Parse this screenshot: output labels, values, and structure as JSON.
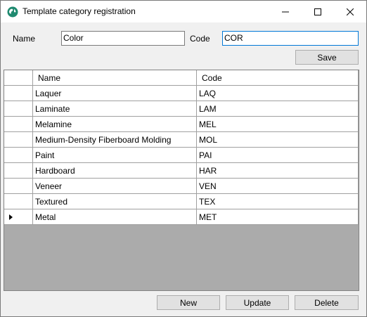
{
  "window": {
    "title": "Template category registration",
    "icons": {
      "app": "globe-icon",
      "minimize": "minimize-icon",
      "maximize": "maximize-icon",
      "close": "close-icon"
    }
  },
  "form": {
    "name_label": "Name",
    "name_value": "Color",
    "code_label": "Code",
    "code_value": "COR",
    "save_label": "Save"
  },
  "grid": {
    "columns": [
      "Name",
      "Code"
    ],
    "rows": [
      {
        "name": "Laquer",
        "code": "LAQ"
      },
      {
        "name": "Laminate",
        "code": "LAM"
      },
      {
        "name": "Melamine",
        "code": "MEL"
      },
      {
        "name": "Medium-Density Fiberboard Molding",
        "code": "MOL"
      },
      {
        "name": "Paint",
        "code": "PAI"
      },
      {
        "name": "Hardboard",
        "code": "HAR"
      },
      {
        "name": "Veneer",
        "code": "VEN"
      },
      {
        "name": "Textured",
        "code": "TEX"
      },
      {
        "name": "Metal",
        "code": "MET"
      }
    ],
    "current_row_indicator": "row-pointer-icon"
  },
  "actions": {
    "new_label": "New",
    "update_label": "Update",
    "delete_label": "Delete"
  },
  "colors": {
    "focus_border": "#0078d7",
    "grid_background": "#ababab",
    "button_face": "#e1e1e1"
  }
}
